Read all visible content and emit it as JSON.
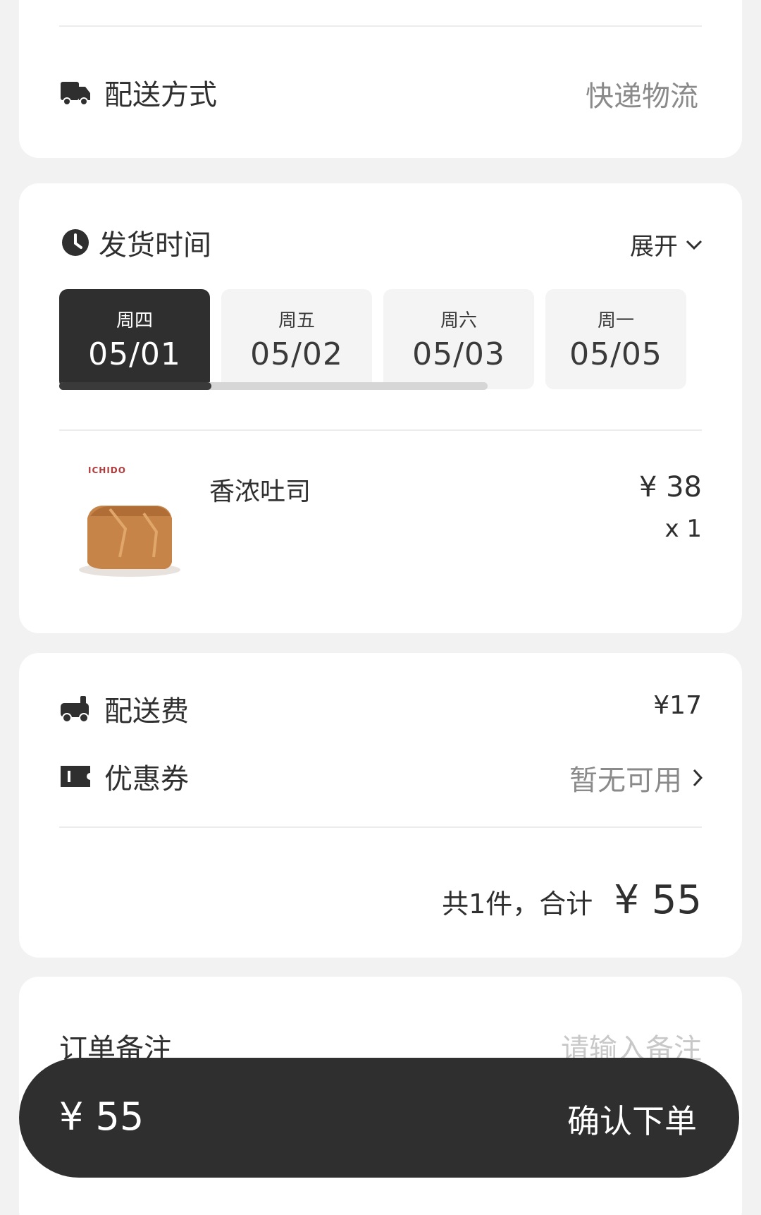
{
  "delivery": {
    "label": "配送方式",
    "value": "快递物流",
    "icon": "truck-icon"
  },
  "ship_time": {
    "label": "发货时间",
    "expand": "展开",
    "icon": "clock-icon",
    "dates": [
      {
        "weekday": "周四",
        "date": "05/01",
        "selected": true
      },
      {
        "weekday": "周五",
        "date": "05/02",
        "selected": false
      },
      {
        "weekday": "周六",
        "date": "05/03",
        "selected": false
      },
      {
        "weekday": "周一",
        "date": "05/05",
        "selected": false
      }
    ]
  },
  "product": {
    "brand": "ICHIDO",
    "name": "香浓吐司",
    "price": "¥ 38",
    "qty": "x 1"
  },
  "fees": {
    "shipping_label": "配送费",
    "shipping_value": "¥17",
    "coupon_label": "优惠券",
    "coupon_value": "暂无可用",
    "summary_label": "共1件，合计",
    "total": "¥ 55"
  },
  "remark": {
    "label": "订单备注",
    "placeholder": "请输入备注"
  },
  "bottom": {
    "total": "¥ 55",
    "confirm": "确认下单"
  },
  "colors": {
    "dark": "#2f2f2f",
    "muted": "#8a8a8a",
    "bg": "#f2f2f2"
  }
}
